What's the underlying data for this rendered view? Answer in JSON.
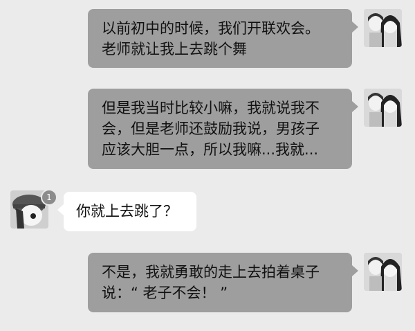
{
  "messages": [
    {
      "side": "right",
      "lines": [
        "以前初中的时候，我们开联欢会。",
        "老师就让我上去跳个舞"
      ]
    },
    {
      "side": "right",
      "lines": [
        "但是我当时比较小嘛，我就说我不",
        "会，但是老师还鼓励我说，男孩子",
        "应该大胆一点，所以我嘛...我就..."
      ]
    },
    {
      "side": "left",
      "badge": "1",
      "lines": [
        "你就上去跳了？"
      ]
    },
    {
      "side": "right",
      "lines": [
        "不是，我就勇敢的走上去拍着桌子",
        "说：“ 老子不会！ ”"
      ]
    }
  ],
  "colors": {
    "background": "#ebebeb",
    "outgoing_bubble": "#9e9e9e",
    "incoming_bubble": "#ffffff"
  }
}
